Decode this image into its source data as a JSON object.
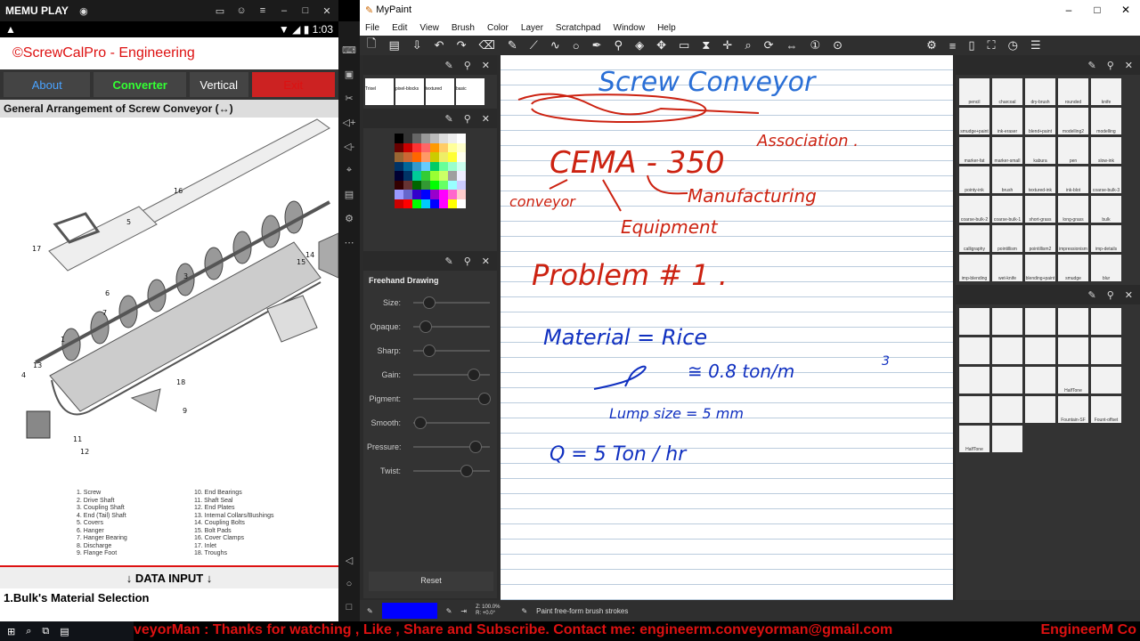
{
  "memu": {
    "logo": "MEMU PLAY",
    "time": "1:03"
  },
  "app": {
    "title": "©ScrewCalPro - Engineering",
    "btn_about": "About",
    "btn_converter": "Converter",
    "btn_vertical": "Vertical",
    "btn_exit": "Exit",
    "ga_title": "General Arrangement of Screw Conveyor (↔)",
    "legend": [
      "1.   Screw",
      "10.   End Bearings",
      "2.   Drive Shaft",
      "11.   Shaft Seal",
      "3.   Coupling Shaft",
      "12.   End Plates",
      "4.   End (Tail) Shaft",
      "13.   Internal Collars/Bushings",
      "5.   Covers",
      "14.   Coupling Bolts",
      "6.   Hanger",
      "15.   Bolt Pads",
      "7.   Hanger Bearing",
      "16.   Cover Clamps",
      "8.   Discharge",
      "17.   Inlet",
      "9.   Flange Foot",
      "18.   Troughs"
    ],
    "data_input": "↓ DATA INPUT ↓",
    "bulk_title": "1.Bulk's Material Selection",
    "callouts": [
      "16",
      "5",
      "17",
      "3",
      "6",
      "7",
      "1",
      "13",
      "4",
      "18",
      "9",
      "11",
      "12",
      "14",
      "15"
    ]
  },
  "mypaint": {
    "title": "MyPaint",
    "menu": [
      "File",
      "Edit",
      "View",
      "Brush",
      "Color",
      "Layer",
      "Scratchpad",
      "Window",
      "Help"
    ],
    "brush_labels": [
      "Trixel",
      "pixel-blocks",
      "textured",
      "basic"
    ],
    "tool_title": "Freehand Drawing",
    "sliders": [
      {
        "label": "Size:",
        "value": 0.22
      },
      {
        "label": "Opaque:",
        "value": 0.18
      },
      {
        "label": "Sharp:",
        "value": 0.22
      },
      {
        "label": "Gain:",
        "value": 0.85
      },
      {
        "label": "Pigment:",
        "value": 1.0
      },
      {
        "label": "Smooth:",
        "value": 0.1
      },
      {
        "label": "Pressure:",
        "value": 0.88
      },
      {
        "label": "Twist:",
        "value": 0.75
      }
    ],
    "reset": "Reset",
    "right_brushes": [
      "pencil",
      "charcoal",
      "dry-brush",
      "rounded",
      "knife",
      "smudge+paint",
      "ink-eraser",
      "blend+paint",
      "modelling2",
      "modelling",
      "marker-fat",
      "marker-small",
      "kabura",
      "pen",
      "slow-ink",
      "pointy-ink",
      "brush",
      "textured-ink",
      "ink-blot",
      "coarse-bulk-3",
      "coarse-bulk-2",
      "coarse-bulk-1",
      "short-grass",
      "long-grass",
      "bulk",
      "calligraphy",
      "pointillism",
      "pointillism2",
      "impressionism",
      "imp-details",
      "imp-blending",
      "wet-knife",
      "blending+paint",
      "smudge",
      "blur"
    ],
    "lower_brushes": [
      "",
      "",
      "",
      "",
      "",
      "",
      "",
      "",
      "",
      "",
      "",
      "",
      "",
      "HalfTone",
      "",
      "",
      "",
      "",
      "Fountain-SF",
      "Fount-offset",
      "HalfTone",
      ""
    ],
    "status": "Paint free-form brush strokes",
    "zoom": "Z: 100.0%",
    "rot": "R: +0.0°"
  },
  "notes": {
    "title": "Screw  Conveyor",
    "assoc": "Association .",
    "cema": "CEMA - 350",
    "conv": "conveyor",
    "manuf": "Manufacturing",
    "equip": "Equipment",
    "problem": "Problem # 1 .",
    "material": "Material =  Rice",
    "rho": "≅  0.8 ton/m",
    "rho_exp": "3",
    "lump": "Lump size  =  5 mm",
    "q": "Q  =  5 Ton / hr"
  },
  "ticker": {
    "text": "veyorMan : Thanks for watching , Like , Share and Subscribe. Contact me: engineerm.conveyorman@gmail.com",
    "brand": "EngineerM Co"
  }
}
